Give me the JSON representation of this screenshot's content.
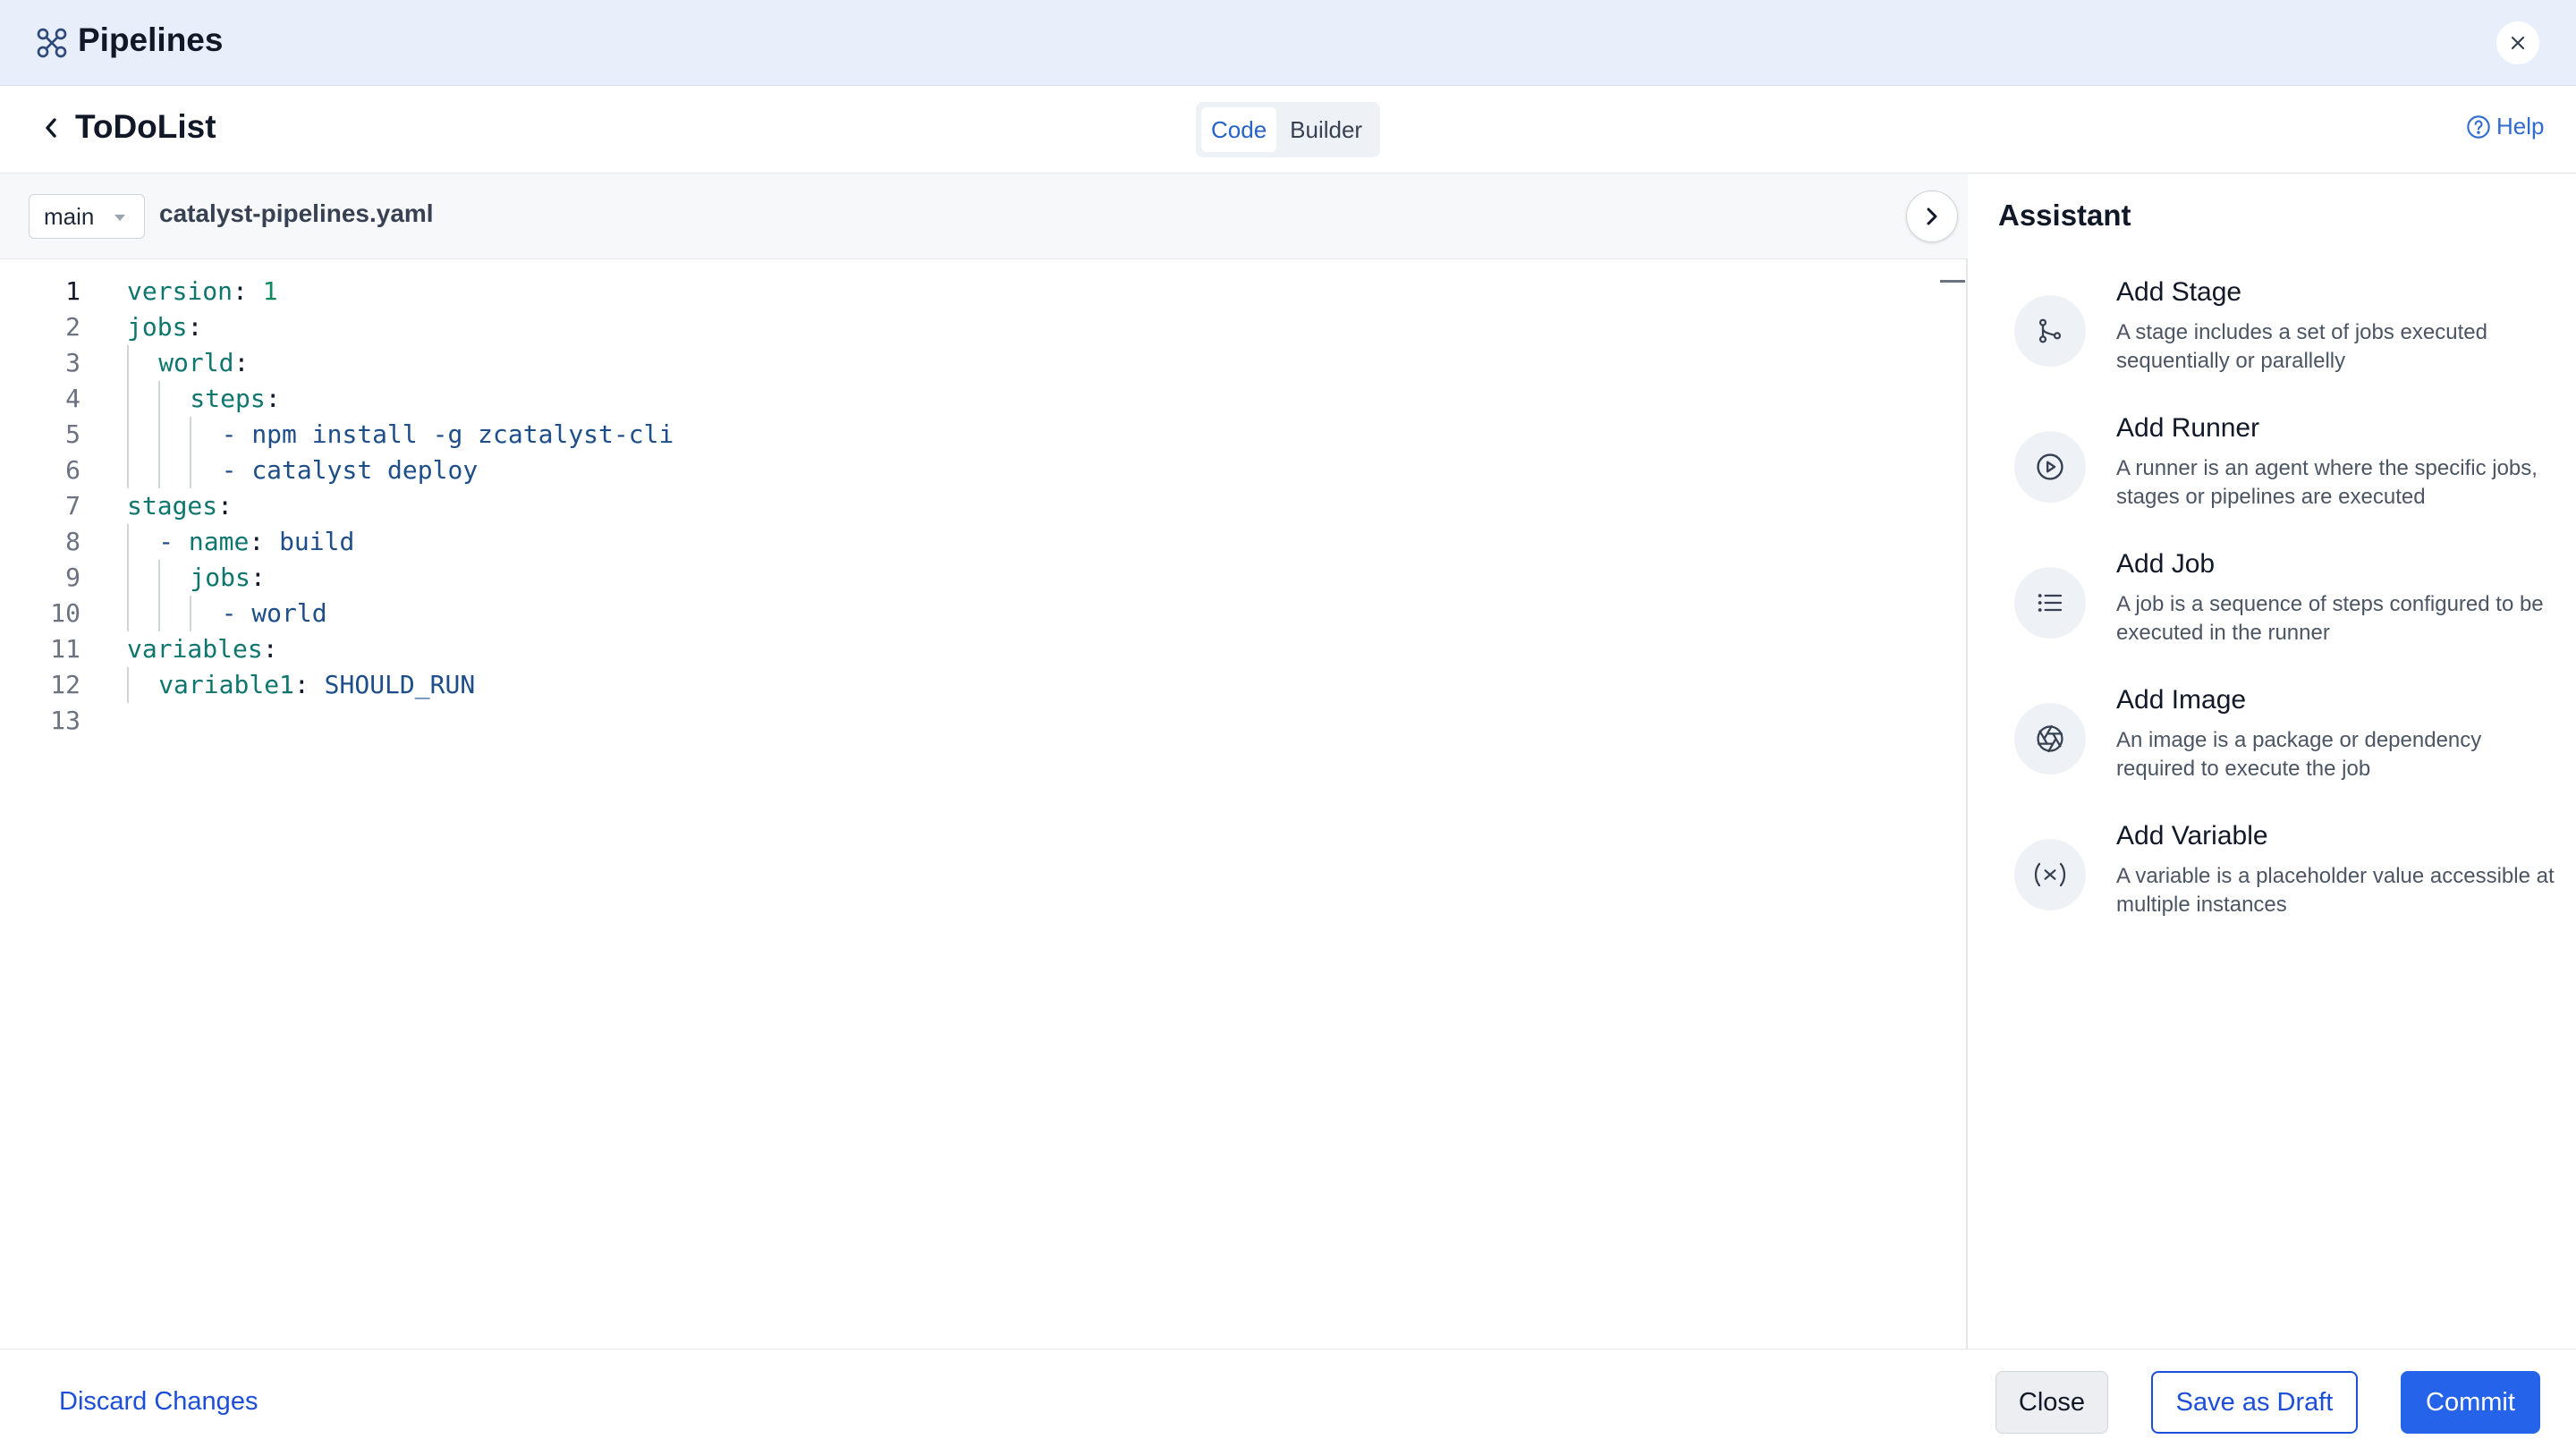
{
  "app": {
    "title": "Pipelines"
  },
  "header": {
    "project_title": "ToDoList",
    "modes": [
      "Code",
      "Builder"
    ],
    "active_mode": "Code",
    "help_label": "Help"
  },
  "editor": {
    "branch": "main",
    "file_name": "catalyst-pipelines.yaml",
    "current_line": 1,
    "lines": [
      "version: 1",
      "jobs:",
      "  world:",
      "    steps:",
      "      - npm install -g zcatalyst-cli",
      "      - catalyst deploy",
      "stages:",
      "  - name: build",
      "    jobs:",
      "      - world",
      "variables:",
      "  variable1: SHOULD_RUN",
      ""
    ]
  },
  "assistant": {
    "title": "Assistant",
    "items": [
      {
        "icon": "stage-icon",
        "title": "Add Stage",
        "desc": "A stage includes a set of jobs executed sequentially or parallelly"
      },
      {
        "icon": "play-circle-icon",
        "title": "Add Runner",
        "desc": "A runner is an agent where the specific jobs, stages or pipelines are executed"
      },
      {
        "icon": "list-icon",
        "title": "Add Job",
        "desc": "A job is a sequence of steps configured to be executed in the runner"
      },
      {
        "icon": "aperture-icon",
        "title": "Add Image",
        "desc": "An image is a package or dependency required to execute the job"
      },
      {
        "icon": "variable-icon",
        "title": "Add Variable",
        "desc": "A variable is a placeholder value accessible at multiple instances"
      }
    ]
  },
  "footer": {
    "discard_label": "Discard Changes",
    "close_label": "Close",
    "draft_label": "Save as Draft",
    "commit_label": "Commit"
  },
  "colors": {
    "accent": "#2563eb",
    "titlebar_bg": "#e8effb",
    "code_key": "#0f766e",
    "code_value": "#1d4e89"
  }
}
